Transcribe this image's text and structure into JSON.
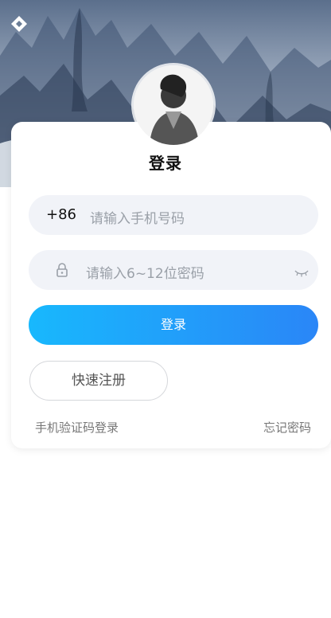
{
  "header": {
    "logo_icon": "diamond-logo-icon"
  },
  "login": {
    "title": "登录",
    "phone_prefix": "+86",
    "phone_placeholder": "请输入手机号码",
    "password_placeholder": "请输入6~12位密码",
    "lock_icon": "lock-icon",
    "eye_icon": "eye-closed-icon",
    "submit_label": "登录",
    "register_label": "快速注册",
    "sms_login_label": "手机验证码登录",
    "forgot_label": "忘记密码"
  },
  "colors": {
    "accent_start": "#18b8fd",
    "accent_end": "#2a86f7",
    "field_bg": "#f1f3f8",
    "placeholder": "#9aa0a8"
  }
}
